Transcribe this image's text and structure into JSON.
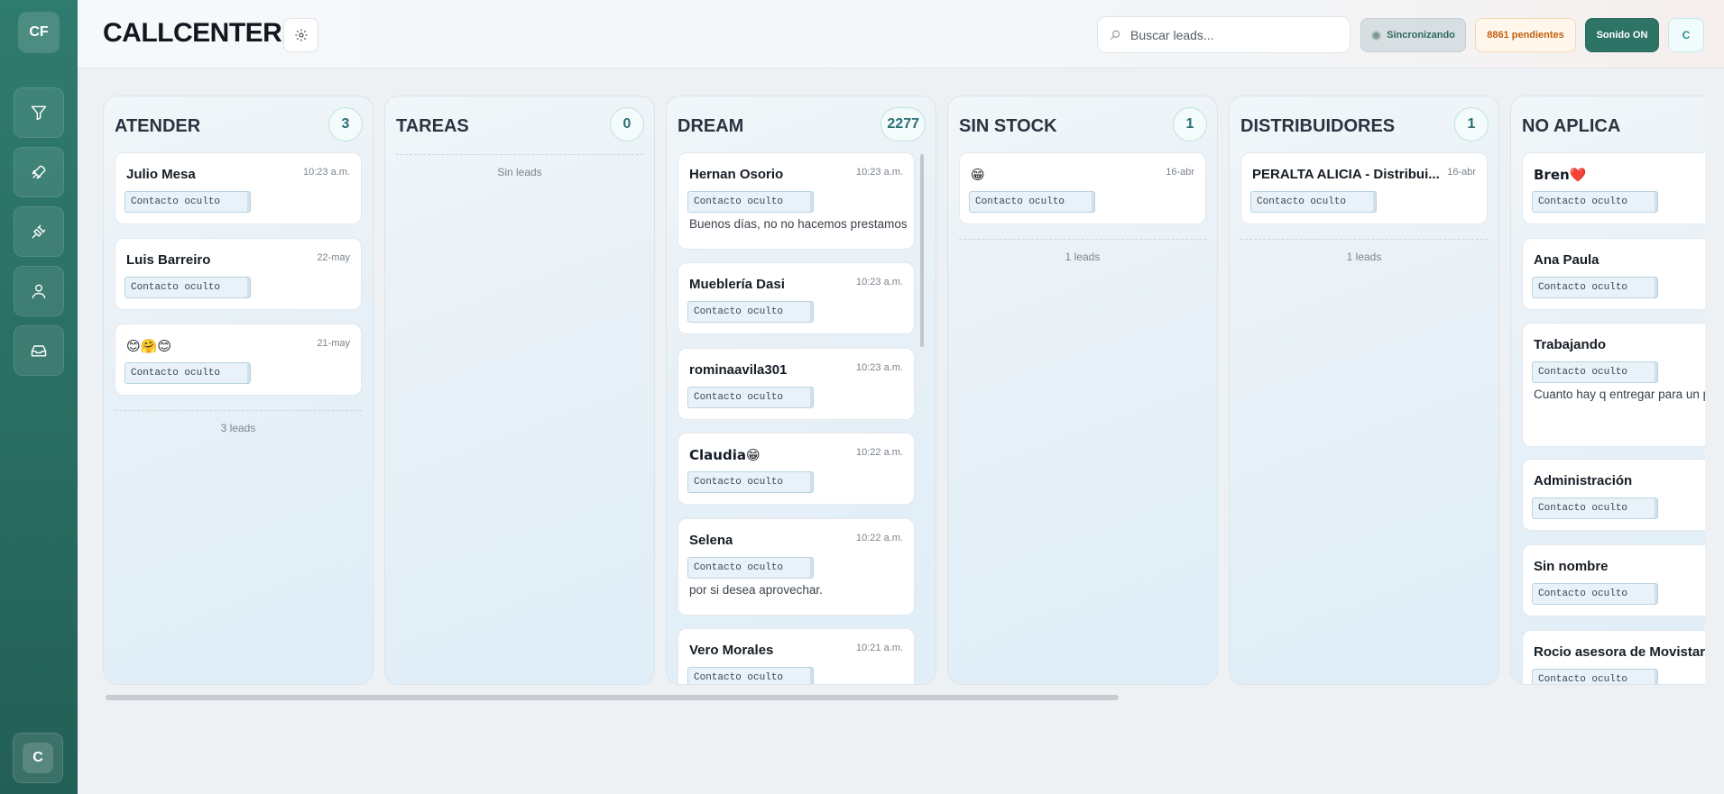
{
  "sidebar": {
    "logo": "CF",
    "nav": [
      {
        "icon": "filter-icon"
      },
      {
        "icon": "rocket-icon"
      },
      {
        "icon": "plug-icon"
      },
      {
        "icon": "user-icon"
      },
      {
        "icon": "inbox-icon"
      }
    ],
    "user_initial": "C"
  },
  "header": {
    "title": "CALLCENTER",
    "search_placeholder": "Buscar leads...",
    "sync_label": "Sincronizando",
    "pending_label": "8861 pendientes",
    "sound_label": "Sonido ON",
    "user_initial": "C"
  },
  "colors": {
    "sidebar": "#2a6e63",
    "accent": "#2e7466",
    "pending": "#c2600e"
  },
  "columns": [
    {
      "title": "ATENDER",
      "count": "3",
      "footer": "3 leads",
      "cards": [
        {
          "name": "Julio Mesa",
          "time": "10:23 a.m.",
          "contact": "Contacto oculto",
          "message": ""
        },
        {
          "name": "Luis Barreiro",
          "time": "22-may",
          "contact": "Contacto oculto",
          "message": ""
        },
        {
          "name": "😊🤗😊",
          "time": "21-may",
          "contact": "Contacto oculto",
          "message": ""
        }
      ]
    },
    {
      "title": "TAREAS",
      "count": "0",
      "footer": "Sin leads",
      "cards": []
    },
    {
      "title": "DREAM",
      "count": "2277",
      "footer": "",
      "cards": [
        {
          "name": "Hernan Osorio",
          "time": "10:23 a.m.",
          "contact": "Contacto oculto",
          "message": "Buenos días, no no hacemos prestamos"
        },
        {
          "name": "Mueblería Dasi",
          "time": "10:23 a.m.",
          "contact": "Contacto oculto",
          "message": ""
        },
        {
          "name": "rominaavila301",
          "time": "10:23 a.m.",
          "contact": "Contacto oculto",
          "message": ""
        },
        {
          "name": "Claudia😁",
          "time": "10:22 a.m.",
          "contact": "Contacto oculto",
          "message": ""
        },
        {
          "name": "Selena",
          "time": "10:22 a.m.",
          "contact": "Contacto oculto",
          "message": "por si desea aprovechar."
        },
        {
          "name": "Vero Morales",
          "time": "10:21 a.m.",
          "contact": "Contacto oculto",
          "message": ""
        }
      ]
    },
    {
      "title": "SIN STOCK",
      "count": "1",
      "footer": "1 leads",
      "cards": [
        {
          "name": "😁",
          "time": "16-abr",
          "contact": "Contacto oculto",
          "message": ""
        }
      ]
    },
    {
      "title": "DISTRIBUIDORES",
      "count": "1",
      "footer": "1 leads",
      "cards": [
        {
          "name": "PERALTA ALICIA - Distribui...",
          "time": "16-abr",
          "contact": "Contacto oculto",
          "message": ""
        }
      ]
    },
    {
      "title": "NO APLICA",
      "count": "",
      "footer": "",
      "cards": [
        {
          "name": "Bren❤️",
          "time": "",
          "contact": "Contacto oculto",
          "message": ""
        },
        {
          "name": "Ana Paula",
          "time": "",
          "contact": "Contacto oculto",
          "message": ""
        },
        {
          "name": "Trabajando",
          "time": "",
          "contact": "Contacto oculto",
          "message": "Cuanto hay q entregar para un pi"
        },
        {
          "name": "Administración",
          "time": "",
          "contact": "Contacto oculto",
          "message": ""
        },
        {
          "name": "Sin nombre",
          "time": "",
          "contact": "Contacto oculto",
          "message": ""
        },
        {
          "name": "Rocio asesora de Movistar",
          "time": "",
          "contact": "Contacto oculto",
          "message": ""
        }
      ]
    }
  ]
}
